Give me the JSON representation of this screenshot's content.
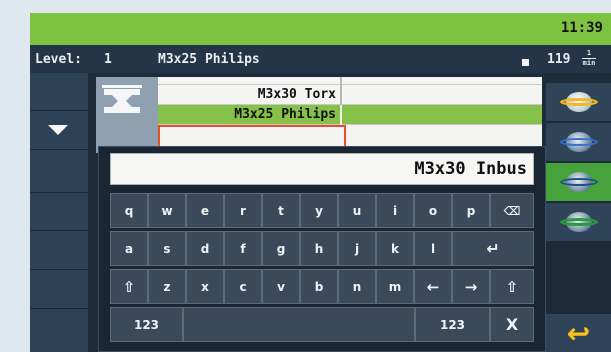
{
  "header": {
    "time": "11:39"
  },
  "status": {
    "level_label": "Level:",
    "level_value": "1",
    "program": "M3x25 Philips",
    "speed_value": "119",
    "speed_unit_num": "1",
    "speed_unit_den": "min"
  },
  "program_list": {
    "rows": [
      {
        "name": "M3x30 Torx"
      },
      {
        "name": "M3x25 Philips",
        "selected": true
      }
    ]
  },
  "keyboard": {
    "input_value": "M3x30 Inbus",
    "row1": [
      "q",
      "w",
      "e",
      "r",
      "t",
      "y",
      "u",
      "i",
      "o",
      "p",
      "⌫"
    ],
    "row2": [
      "a",
      "s",
      "d",
      "f",
      "g",
      "h",
      "j",
      "k",
      "l",
      "↵"
    ],
    "row3": [
      "⇧",
      "z",
      "x",
      "c",
      "v",
      "b",
      "n",
      "m",
      "←",
      "→",
      "⇧"
    ],
    "numeric_left": "123",
    "numeric_right": "123",
    "close": "X"
  },
  "sidebar_right": {
    "icons": [
      "rotate-sphere-icon",
      "sphere-blue-ring-icon",
      "sphere-active-icon",
      "sphere-green-ring-icon"
    ],
    "back_icon": "back-arrow-icon",
    "back_glyph": "↩"
  },
  "colors": {
    "accent_green": "#7ec242",
    "selected_row": "#86c24a",
    "back_yellow": "#ffc21a",
    "background": "#1d2c3a"
  }
}
